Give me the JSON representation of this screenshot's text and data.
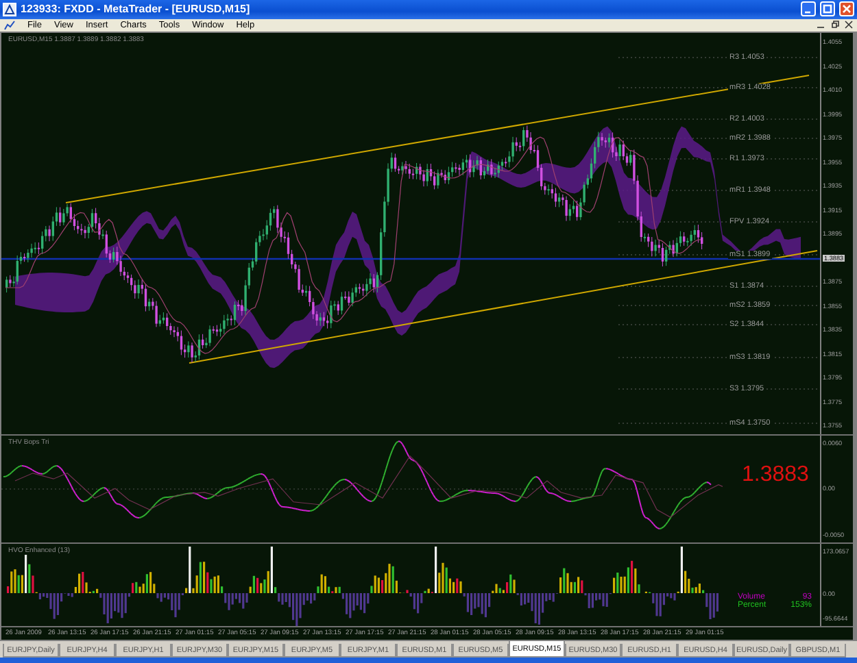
{
  "window": {
    "title": "123933: FXDD - MetaTrader - [EURUSD,M15]"
  },
  "menu": [
    "File",
    "View",
    "Insert",
    "Charts",
    "Tools",
    "Window",
    "Help"
  ],
  "chart": {
    "header": "EURUSD,M15 1.3887 1.3889 1.3882 1.3883",
    "pivots": [
      "R3 1.4053",
      "mR3 1.4028",
      "R2 1.4003",
      "mR2 1.3988",
      "R1 1.3973",
      "mR1 1.3948",
      "FPV 1.3924",
      "mS1 1.3899",
      "S1 1.3874",
      "mS2 1.3859",
      "S2 1.3844",
      "mS3 1.3819",
      "S3 1.3795",
      "mS4 1.3750"
    ],
    "price_axis": [
      {
        "text": "1.4055",
        "highlighted": false
      },
      {
        "text": "1.4025",
        "highlighted": false
      },
      {
        "text": "1.4010",
        "highlighted": false
      },
      {
        "text": "1.3995",
        "highlighted": false
      },
      {
        "text": "1.3975",
        "highlighted": false
      },
      {
        "text": "1.3955",
        "highlighted": false
      },
      {
        "text": "1.3935",
        "highlighted": false
      },
      {
        "text": "1.3915",
        "highlighted": false
      },
      {
        "text": "1.3895",
        "highlighted": false
      },
      {
        "text": "1.3883",
        "highlighted": true
      },
      {
        "text": "1.3875",
        "highlighted": false
      },
      {
        "text": "1.3855",
        "highlighted": false
      },
      {
        "text": "1.3835",
        "highlighted": false
      },
      {
        "text": "1.3815",
        "highlighted": false
      },
      {
        "text": "1.3795",
        "highlighted": false
      },
      {
        "text": "1.3775",
        "highlighted": false
      },
      {
        "text": "1.3755",
        "highlighted": false
      }
    ]
  },
  "indicators": [
    {
      "kind": "oscillator",
      "name": "THV Bops Tri",
      "axis": [
        "0.0060",
        "0.00",
        "-0.0050"
      ],
      "reading": "1.3883"
    },
    {
      "kind": "histogram",
      "name": "HVO Enhanced (13)",
      "axis": [
        "173.0657",
        "0.00",
        "-95.6644"
      ],
      "legend": [
        {
          "label": "Volume",
          "value": "93",
          "color": "#c000c0"
        },
        {
          "label": "Percent",
          "value": "153%",
          "color": "#20c020"
        }
      ]
    }
  ],
  "time_axis": [
    "26 Jan 2009",
    "26 Jan 13:15",
    "26 Jan 17:15",
    "26 Jan 21:15",
    "27 Jan 01:15",
    "27 Jan 05:15",
    "27 Jan 09:15",
    "27 Jan 13:15",
    "27 Jan 17:15",
    "27 Jan 21:15",
    "28 Jan 01:15",
    "28 Jan 05:15",
    "28 Jan 09:15",
    "28 Jan 13:15",
    "28 Jan 17:15",
    "28 Jan 21:15",
    "29 Jan 01:15"
  ],
  "tabs": [
    {
      "label": "EURJPY,Daily",
      "selected": false
    },
    {
      "label": "EURJPY,H4",
      "selected": false
    },
    {
      "label": "EURJPY,H1",
      "selected": false
    },
    {
      "label": "EURJPY,M30",
      "selected": false
    },
    {
      "label": "EURJPY,M15",
      "selected": false
    },
    {
      "label": "EURJPY,M5",
      "selected": false
    },
    {
      "label": "EURJPY,M1",
      "selected": false
    },
    {
      "label": "EURUSD,M1",
      "selected": false
    },
    {
      "label": "EURUSD,M5",
      "selected": false
    },
    {
      "label": "EURUSD,M15",
      "selected": true
    },
    {
      "label": "EURUSD,M30",
      "selected": false
    },
    {
      "label": "EURUSD,H1",
      "selected": false
    },
    {
      "label": "EURUSD,H4",
      "selected": false
    },
    {
      "label": "EURUSD,Daily",
      "selected": false
    },
    {
      "label": "GBPUSD,M1",
      "selected": false
    }
  ]
}
